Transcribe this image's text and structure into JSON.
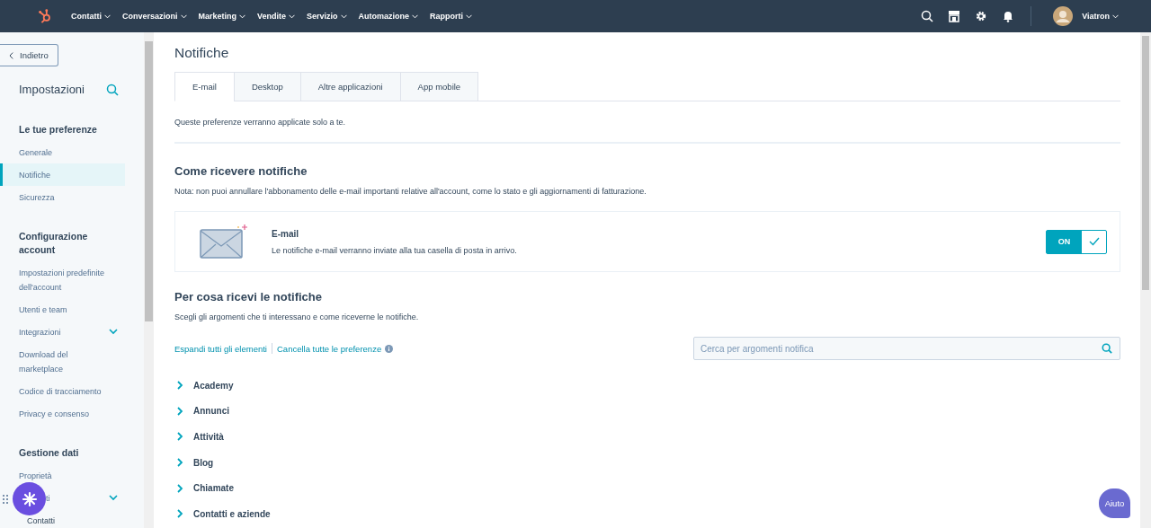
{
  "nav": {
    "items": [
      "Contatti",
      "Conversazioni",
      "Marketing",
      "Vendite",
      "Servizio",
      "Automazione",
      "Rapporti"
    ],
    "user": "Viatron"
  },
  "sidebar": {
    "back": "Indietro",
    "title": "Impostazioni",
    "sections": [
      {
        "heading": "Le tue preferenze",
        "items": [
          {
            "label": "Generale",
            "selected": false
          },
          {
            "label": "Notifiche",
            "selected": true
          },
          {
            "label": "Sicurezza",
            "selected": false
          }
        ]
      },
      {
        "heading": "Configurazione account",
        "items": [
          {
            "label": "Impostazioni predefinite dell'account",
            "selected": false
          },
          {
            "label": "Utenti e team",
            "selected": false
          },
          {
            "label": "Integrazioni",
            "selected": false,
            "kind": "expandable"
          },
          {
            "label": "Download del marketplace",
            "selected": false
          },
          {
            "label": "Codice di tracciamento",
            "selected": false
          },
          {
            "label": "Privacy e consenso",
            "selected": false
          }
        ]
      },
      {
        "heading": "Gestione dati",
        "items": [
          {
            "label": "Proprietà",
            "selected": false
          },
          {
            "label": "ti",
            "selected": false,
            "kind": "expandable",
            "covered": true,
            "children": [
              {
                "label": "Contatti",
                "selected": false
              }
            ]
          }
        ]
      }
    ]
  },
  "page": {
    "title": "Notifiche",
    "tabs": [
      {
        "label": "E-mail",
        "selected": true
      },
      {
        "label": "Desktop",
        "selected": false
      },
      {
        "label": "Altre applicazioni",
        "selected": false
      },
      {
        "label": "App mobile",
        "selected": false
      }
    ],
    "intro": "Queste preferenze verranno applicate solo a te.",
    "how": {
      "heading": "Come ricevere notifiche",
      "note": "Nota: non puoi annullare l'abbonamento delle e-mail importanti relative all'account, come lo stato e gli aggiornamenti di fatturazione.",
      "channel": {
        "title": "E-mail",
        "description": "Le notifiche e-mail verranno inviate alla tua casella di posta in arrivo.",
        "on": true,
        "toggle_label": "ON"
      }
    },
    "what": {
      "heading": "Per cosa ricevi le notifiche",
      "description": "Scegli gli argomenti che ti interessano e come riceverne le notifiche.",
      "expand_all": "Espandi tutti gli elementi",
      "clear_all": "Cancella tutte le preferenze",
      "search": {
        "placeholder": "Cerca per argomenti notifica"
      },
      "topics": [
        {
          "label": "Academy",
          "expanded": false
        },
        {
          "label": "Annunci",
          "expanded": false
        },
        {
          "label": "Attività",
          "expanded": false
        },
        {
          "label": "Blog",
          "expanded": false
        },
        {
          "label": "Chiamate",
          "expanded": false
        },
        {
          "label": "Contatti e aziende",
          "expanded": false
        }
      ]
    }
  },
  "help_button": "Aiuto"
}
